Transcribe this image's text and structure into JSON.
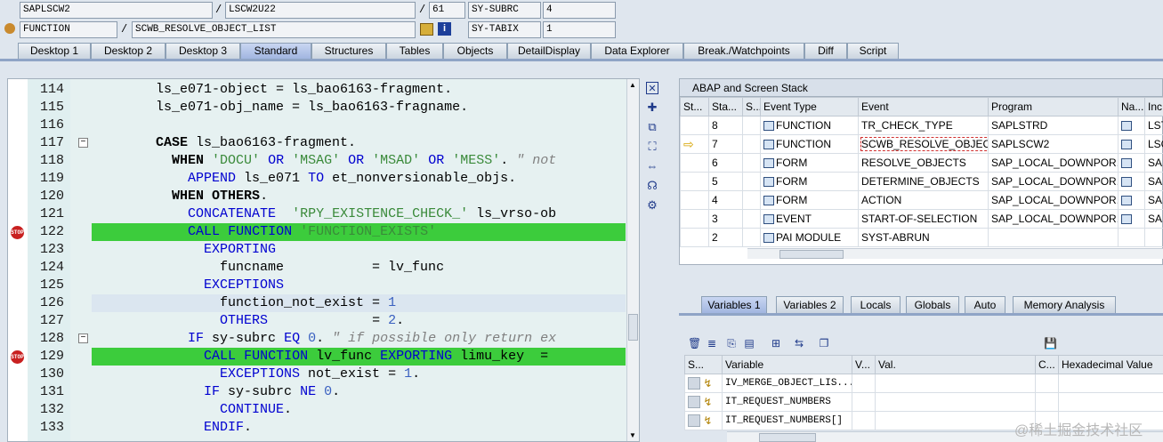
{
  "header": {
    "row1": {
      "program": "SAPLSCW2",
      "include": "LSCW2U22",
      "line": "61",
      "var_label": "SY-SUBRC",
      "var_value": "4"
    },
    "row2": {
      "type": "FUNCTION",
      "name": "SCWB_RESOLVE_OBJECT_LIST",
      "var_label": "SY-TABIX",
      "var_value": "1"
    },
    "sep": "/"
  },
  "tabs": [
    "Desktop 1",
    "Desktop 2",
    "Desktop 3",
    "Standard",
    "Structures",
    "Tables",
    "Objects",
    "DetailDisplay",
    "Data Explorer",
    "Break./Watchpoints",
    "Diff",
    "Script"
  ],
  "active_tab": "Standard",
  "code_lines": [
    {
      "no": "114",
      "text": "        ls_e071-object = ls_bao6163-fragment."
    },
    {
      "no": "115",
      "text": "        ls_e071-obj_name = ls_bao6163-fragname."
    },
    {
      "no": "116",
      "text": ""
    },
    {
      "no": "117",
      "text": "        CASE ls_bao6163-fragment."
    },
    {
      "no": "118",
      "text": "          WHEN 'DOCU' OR 'MSAG' OR 'MSAD' OR 'MESS'. \" not"
    },
    {
      "no": "119",
      "text": "            APPEND ls_e071 TO et_nonversionable_objs."
    },
    {
      "no": "120",
      "text": "          WHEN OTHERS."
    },
    {
      "no": "121",
      "text": "            CONCATENATE  'RPY_EXISTENCE_CHECK_' ls_vrso-ob"
    },
    {
      "no": "122",
      "text": "            CALL FUNCTION 'FUNCTION_EXISTS'"
    },
    {
      "no": "123",
      "text": "              EXPORTING"
    },
    {
      "no": "124",
      "text": "                funcname           = lv_func"
    },
    {
      "no": "125",
      "text": "              EXCEPTIONS"
    },
    {
      "no": "126",
      "text": "                function_not_exist = 1"
    },
    {
      "no": "127",
      "text": "                OTHERS             = 2."
    },
    {
      "no": "128",
      "text": "            IF sy-subrc EQ 0. \" if possible only return ex"
    },
    {
      "no": "129",
      "text": "              CALL FUNCTION lv_func EXPORTING limu_key  ="
    },
    {
      "no": "130",
      "text": "                EXCEPTIONS not_exist = 1."
    },
    {
      "no": "131",
      "text": "              IF sy-subrc NE 0."
    },
    {
      "no": "132",
      "text": "                CONTINUE."
    },
    {
      "no": "133",
      "text": "              ENDIF."
    }
  ],
  "stack": {
    "title": "ABAP and Screen Stack",
    "columns": [
      "St...",
      "Sta...",
      "S...",
      "Event Type",
      "Event",
      "Program",
      "Na...",
      "Inc"
    ],
    "rows": [
      {
        "level": "8",
        "type": "FUNCTION",
        "event": "TR_CHECK_TYPE",
        "program": "SAPLSTRD",
        "inc": "LST"
      },
      {
        "level": "7",
        "type": "FUNCTION",
        "event": "SCWB_RESOLVE_OBJEC...",
        "program": "SAPLSCW2",
        "inc": "LSC"
      },
      {
        "level": "6",
        "type": "FORM",
        "event": "RESOLVE_OBJECTS",
        "program": "SAP_LOCAL_DOWNPOR...",
        "inc": "SAP"
      },
      {
        "level": "5",
        "type": "FORM",
        "event": "DETERMINE_OBJECTS",
        "program": "SAP_LOCAL_DOWNPOR...",
        "inc": "SAP"
      },
      {
        "level": "4",
        "type": "FORM",
        "event": "ACTION",
        "program": "SAP_LOCAL_DOWNPOR...",
        "inc": "SAP"
      },
      {
        "level": "3",
        "type": "EVENT",
        "event": "START-OF-SELECTION",
        "program": "SAP_LOCAL_DOWNPOR...",
        "inc": "SAP"
      },
      {
        "level": "2",
        "type": "PAI MODULE",
        "event": "SYST-ABRUN",
        "program": "",
        "inc": ""
      }
    ]
  },
  "var_tabs": [
    "Variables 1",
    "Variables 2",
    "Locals",
    "Globals",
    "Auto",
    "Memory Analysis"
  ],
  "variables": {
    "columns": [
      "S...",
      "Variable",
      "V...",
      "Val.",
      "C...",
      "Hexadecimal Value"
    ],
    "rows": [
      "IV_MERGE_OBJECT_LIS...",
      "IT_REQUEST_NUMBERS",
      "IT_REQUEST_NUMBERS[]"
    ]
  },
  "watermark": "@稀土掘金技术社区"
}
